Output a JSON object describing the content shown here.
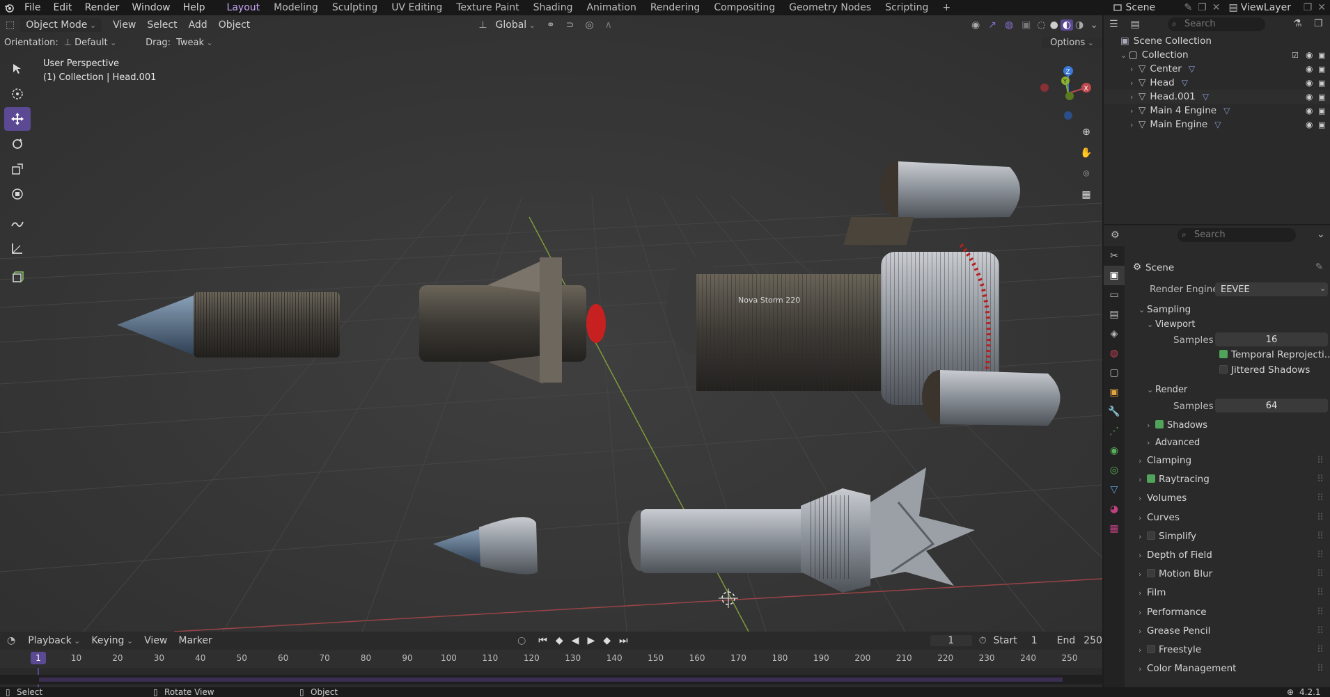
{
  "menu": {
    "items": [
      "File",
      "Edit",
      "Render",
      "Window",
      "Help"
    ]
  },
  "workspaces": {
    "tabs": [
      "Layout",
      "Modeling",
      "Sculpting",
      "UV Editing",
      "Texture Paint",
      "Shading",
      "Animation",
      "Rendering",
      "Compositing",
      "Geometry Nodes",
      "Scripting"
    ],
    "active": "Layout",
    "add": "+"
  },
  "top_right": {
    "scene_label": "Scene",
    "viewlayer_label": "ViewLayer"
  },
  "viewport": {
    "mode": "Object Mode",
    "menus": [
      "View",
      "Select",
      "Add",
      "Object"
    ],
    "transform_orientation": "Global",
    "orientation_label": "Orientation:",
    "orientation_value": "Default",
    "drag_label": "Drag:",
    "drag_value": "Tweak",
    "options_label": "Options",
    "info_line1": "User Perspective",
    "info_line2": "(1) Collection | Head.001",
    "gizmo": {
      "z": "Z",
      "y": "Y",
      "x": "X"
    },
    "model_text": "Nova Storm 220"
  },
  "timeline": {
    "menus": [
      "Playback",
      "Keying",
      "View",
      "Marker"
    ],
    "current_frame": "1",
    "start_label": "Start",
    "start_value": "1",
    "end_label": "End",
    "end_value": "250",
    "ruler": [
      "10",
      "20",
      "30",
      "40",
      "50",
      "60",
      "70",
      "80",
      "90",
      "100",
      "110",
      "120",
      "130",
      "140",
      "150",
      "160",
      "170",
      "180",
      "190",
      "200",
      "210",
      "220",
      "230",
      "240",
      "250"
    ],
    "playhead": "1"
  },
  "statusbar": {
    "select": "Select",
    "rotate": "Rotate View",
    "object": "Object",
    "version": "4.2.1"
  },
  "outliner": {
    "search_placeholder": "Search",
    "scene_collection": "Scene Collection",
    "collection": "Collection",
    "items": [
      "Center",
      "Head",
      "Head.001",
      "Main 4 Engine",
      "Main Engine"
    ]
  },
  "properties": {
    "search_placeholder": "Search",
    "context": "Scene",
    "render_engine_label": "Render Engine",
    "render_engine_value": "EEVEE",
    "sampling": "Sampling",
    "viewport": "Viewport",
    "samples_label": "Samples",
    "viewport_samples": "16",
    "temporal": "Temporal Reprojecti...",
    "jittered": "Jittered Shadows",
    "render": "Render",
    "render_samples": "64",
    "shadows": "Shadows",
    "advanced": "Advanced",
    "panels": [
      "Clamping",
      "Raytracing",
      "Volumes",
      "Curves",
      "Simplify",
      "Depth of Field",
      "Motion Blur",
      "Film",
      "Performance",
      "Grease Pencil",
      "Freestyle",
      "Color Management"
    ]
  },
  "colors": {
    "accent": "#5b4994",
    "active_ws": "#c7a6f6",
    "checkbox_on": "#4fa35b",
    "axis_x": "#c0494f",
    "axis_y": "#8bb232",
    "axis_z": "#3c7ad9"
  }
}
